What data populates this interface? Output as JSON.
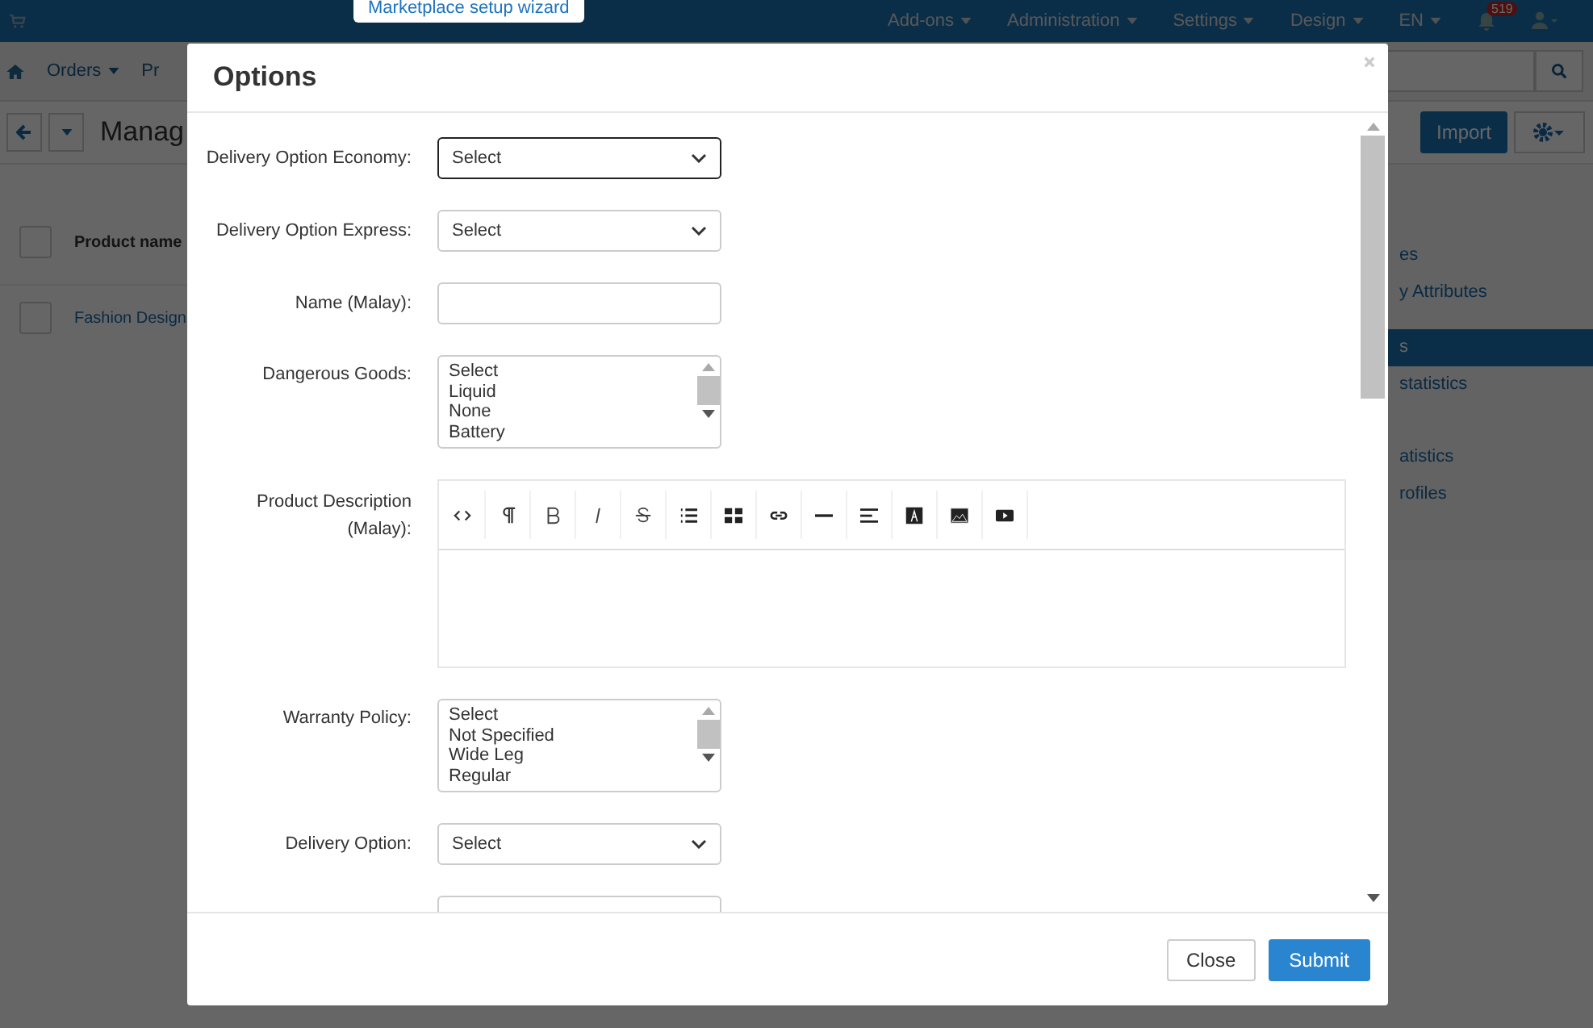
{
  "top_bar": {
    "wizard_button": "Marketplace setup wizard",
    "menu": [
      "Add-ons",
      "Administration",
      "Settings",
      "Design",
      "EN"
    ],
    "notification_count": "519"
  },
  "nav_bar": {
    "items": [
      "Orders",
      "Pr"
    ]
  },
  "page": {
    "title": "Manag",
    "import_button": "Import",
    "table": {
      "header": {
        "label": "Product name",
        "checked": false
      },
      "rows": [
        {
          "label": "Fashion Design",
          "checked": false
        }
      ]
    }
  },
  "sidebar": {
    "items": [
      {
        "label": "es",
        "selected": false
      },
      {
        "label": "y Attributes",
        "selected": false
      },
      {
        "label": "s",
        "selected": true
      },
      {
        "label": "statistics",
        "selected": false
      },
      {
        "label": "atistics",
        "selected": false
      },
      {
        "label": "rofiles",
        "selected": false
      }
    ]
  },
  "dialog": {
    "title": "Options",
    "fields": [
      {
        "kind": "select",
        "label": "Delivery Option Economy:",
        "value": "Select",
        "focused": true
      },
      {
        "kind": "select",
        "label": "Delivery Option Express:",
        "value": "Select",
        "focused": false
      },
      {
        "kind": "text",
        "label": "Name (Malay):"
      },
      {
        "kind": "listbox",
        "label": "Dangerous Goods:",
        "options": [
          "Select",
          "Liquid",
          "None",
          "Battery"
        ]
      },
      {
        "kind": "editor",
        "label": "Product Description (Malay):"
      },
      {
        "kind": "listbox",
        "label": "Warranty Policy:",
        "options": [
          "Select",
          "Not Specified",
          "Wide Leg",
          "Regular"
        ]
      },
      {
        "kind": "select",
        "label": "Delivery Option:",
        "value": "Select",
        "focused": false
      },
      {
        "kind": "select",
        "focused": false
      }
    ],
    "buttons": [
      {
        "label": "Close",
        "kind": "secondary"
      },
      {
        "label": "Submit",
        "kind": "primary"
      }
    ]
  }
}
